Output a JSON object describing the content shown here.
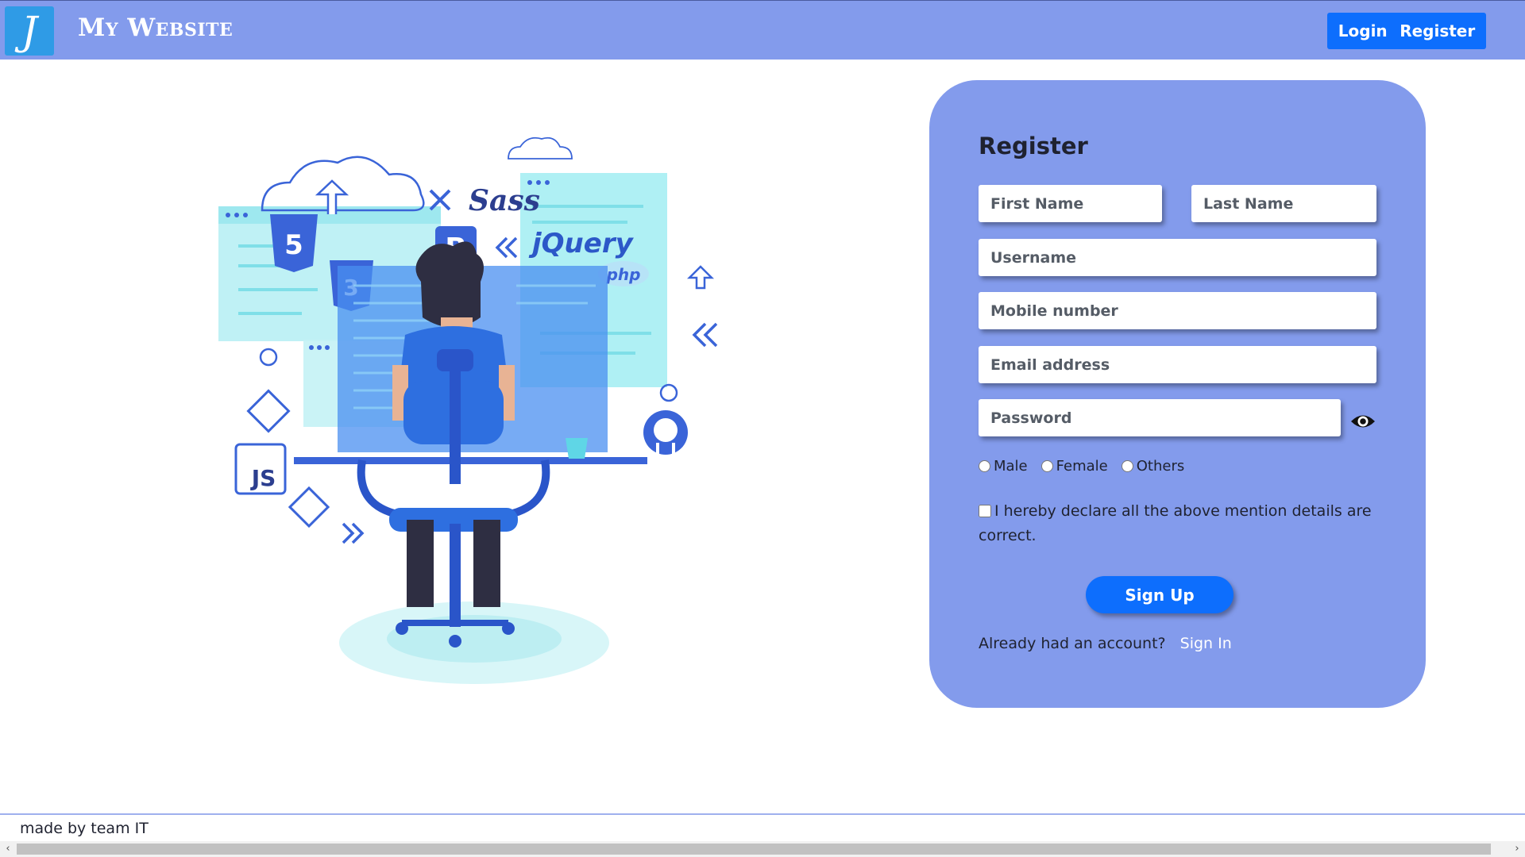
{
  "header": {
    "logo_letter": "J",
    "site_title": "My Website",
    "nav": {
      "login": "Login",
      "register": "Register"
    }
  },
  "illustration": {
    "labels": {
      "sass": "Sass",
      "jquery": "jQuery",
      "php": "php",
      "js": "JS",
      "bootstrap": "B",
      "html5": "5"
    }
  },
  "form": {
    "title": "Register",
    "first_name_placeholder": "First Name",
    "last_name_placeholder": "Last Name",
    "username_placeholder": "Username",
    "mobile_placeholder": "Mobile number",
    "email_placeholder": "Email address",
    "password_placeholder": "Password",
    "gender_options": [
      "Male",
      "Female",
      "Others"
    ],
    "declaration": "I hereby declare all the above mention details are correct.",
    "signup_label": "Sign Up",
    "account_prompt": "Already had an account?",
    "signin_label": "Sign In"
  },
  "footer": {
    "text": "made by team IT"
  },
  "colors": {
    "header_bg": "#839bec",
    "card_bg": "#839bec",
    "accent": "#0d6efd",
    "logo_bg": "#2f9be6"
  },
  "scrollbar": {
    "left_arrow": "‹",
    "right_arrow": "›"
  }
}
